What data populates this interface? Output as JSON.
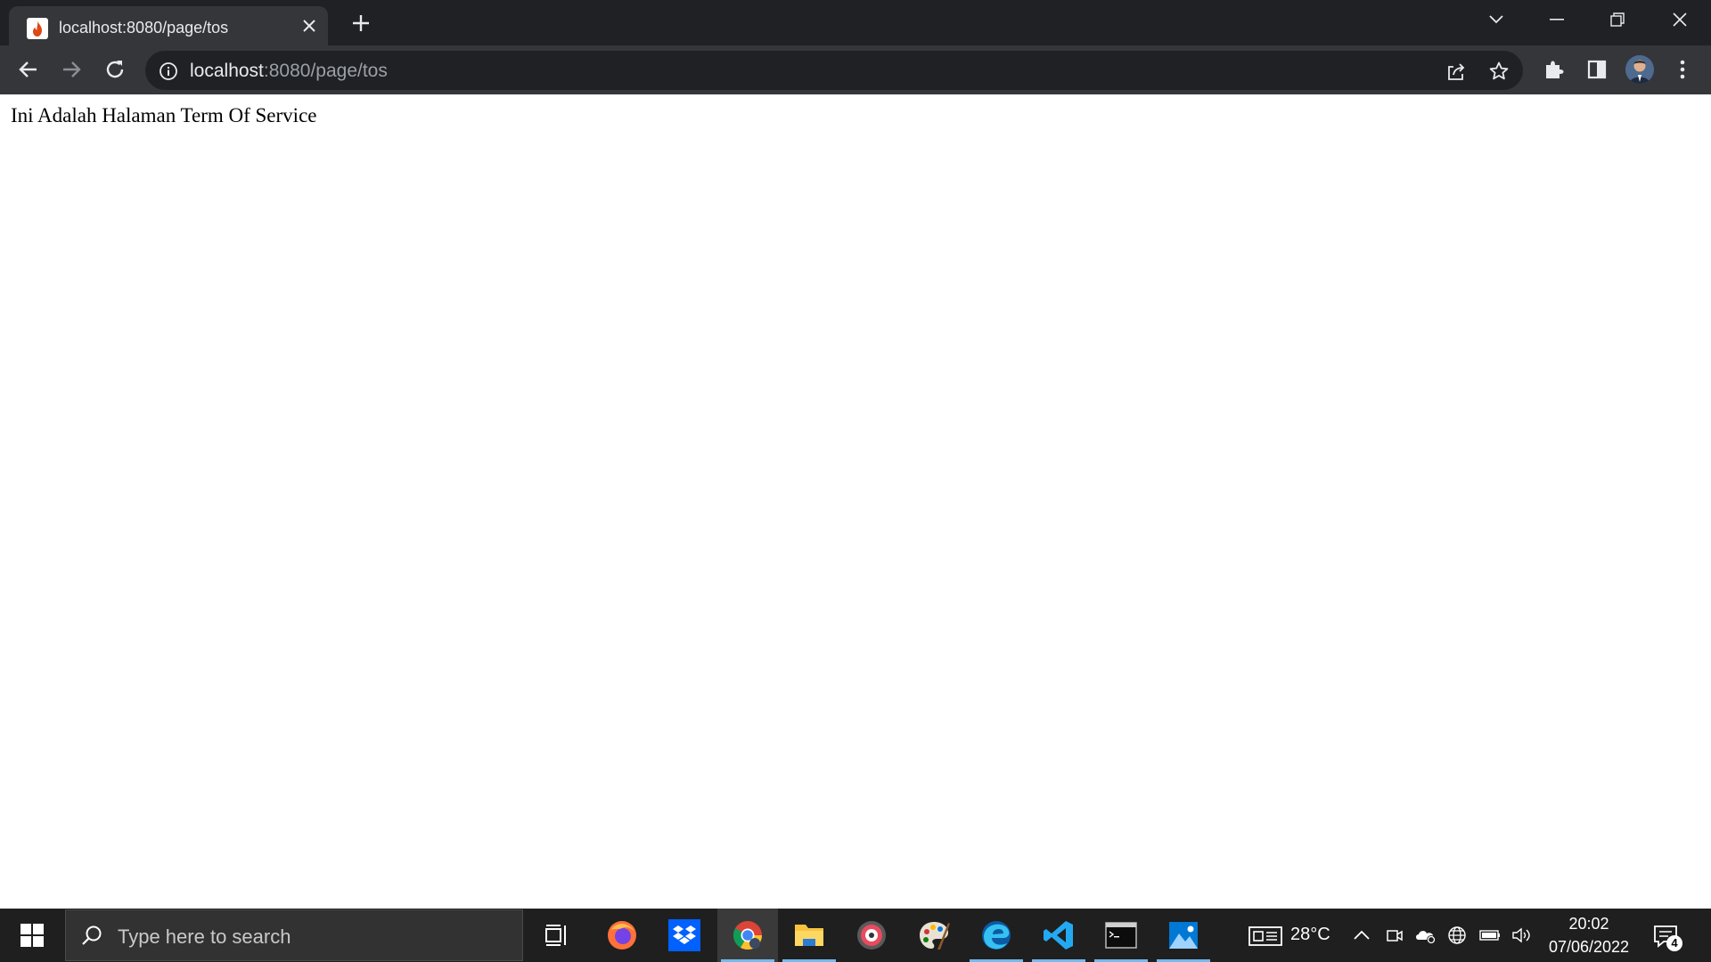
{
  "browser": {
    "tab": {
      "title": "localhost:8080/page/tos",
      "favicon": "codeigniter-flame-icon"
    },
    "address_bar": {
      "host": "localhost",
      "path": ":8080/page/tos"
    },
    "window_controls": [
      "tab-search",
      "minimize",
      "restore",
      "close"
    ],
    "toolbar_icons": [
      "share-icon",
      "bookmark-star-icon",
      "extensions-puzzle-icon",
      "side-panel-icon",
      "profile-avatar",
      "menu-kebab-icon"
    ],
    "colors": {
      "frame": "#202124",
      "toolbar": "#35363a",
      "text": "#e8eaed",
      "muted": "#9aa0a6"
    }
  },
  "page": {
    "text": "Ini Adalah Halaman Term Of Service"
  },
  "taskbar": {
    "search_placeholder": "Type here to search",
    "apps": [
      {
        "name": "task-view-icon"
      },
      {
        "name": "firefox-icon"
      },
      {
        "name": "dropbox-icon"
      },
      {
        "name": "chrome-icon",
        "active": true
      },
      {
        "name": "file-explorer-icon"
      },
      {
        "name": "media-player-icon"
      },
      {
        "name": "paint-palette-icon"
      },
      {
        "name": "edge-icon"
      },
      {
        "name": "vscode-icon"
      },
      {
        "name": "terminal-icon"
      },
      {
        "name": "photos-icon"
      }
    ],
    "weather": "28°C",
    "time": "20:02",
    "date": "07/06/2022",
    "notification_count": "4"
  }
}
